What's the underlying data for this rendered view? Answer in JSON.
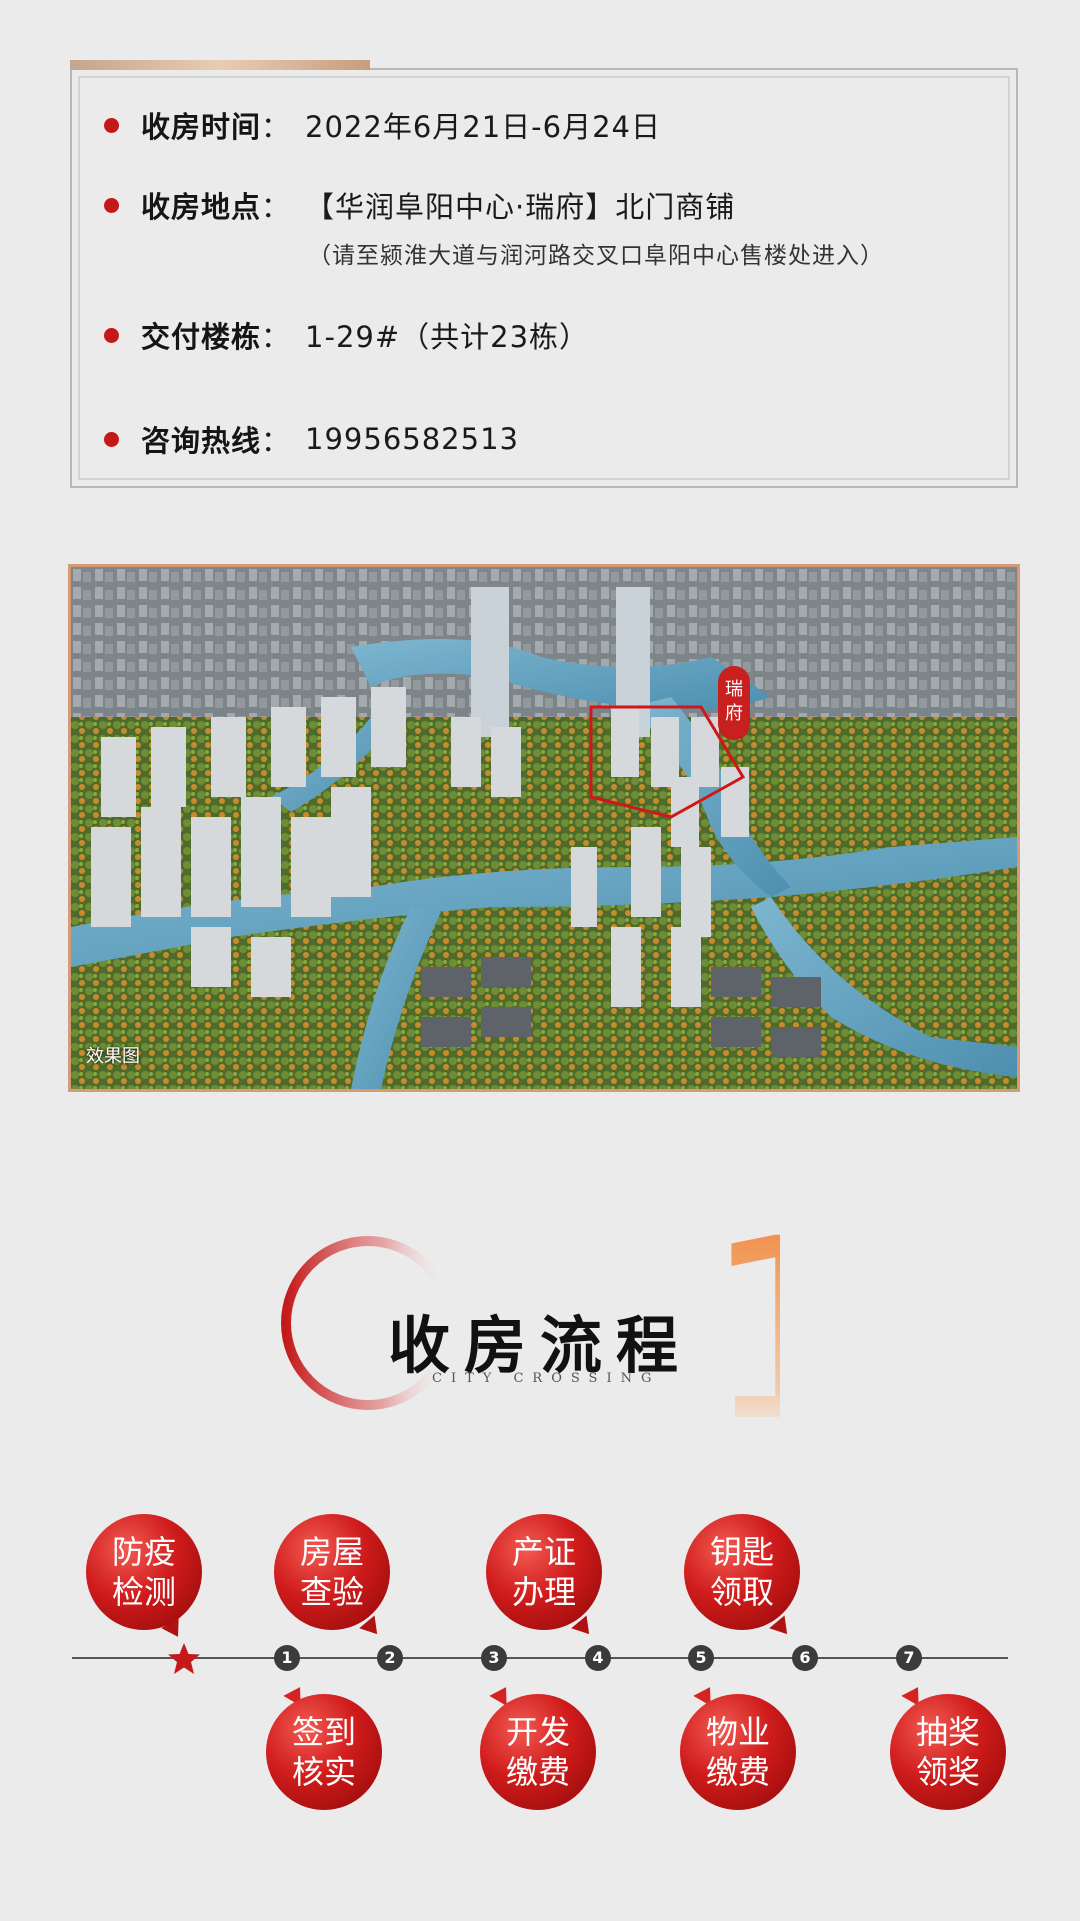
{
  "info": {
    "rows": [
      {
        "label": "收房时间",
        "colon": "：",
        "value": "2022年6月21日-6月24日"
      },
      {
        "label": "收房地点",
        "colon": "：",
        "value": "【华润阜阳中心·瑞府】北门商铺"
      },
      {
        "label": "交付楼栋",
        "colon": "：",
        "value": "1-29#（共计23栋）"
      },
      {
        "label": "咨询热线",
        "colon": "：",
        "value": "19956582513"
      }
    ],
    "location_note": "（请至颍淮大道与润河路交叉口阜阳中心售楼处进入）"
  },
  "aerial": {
    "tag": "瑞府",
    "caption": "效果图"
  },
  "section": {
    "title": "收房流程",
    "subtitle": "CITY CROSSING",
    "number": "1"
  },
  "process": {
    "step_numbers": [
      "1",
      "2",
      "3",
      "4",
      "5",
      "6",
      "7"
    ],
    "top_steps": [
      {
        "line1": "防疫",
        "line2": "检测"
      },
      {
        "line1": "房屋",
        "line2": "查验"
      },
      {
        "line1": "产证",
        "line2": "办理"
      },
      {
        "line1": "钥匙",
        "line2": "领取"
      }
    ],
    "bottom_steps": [
      {
        "line1": "签到",
        "line2": "核实"
      },
      {
        "line1": "开发",
        "line2": "缴费"
      },
      {
        "line1": "物业",
        "line2": "缴费"
      },
      {
        "line1": "抽奖",
        "line2": "领奖"
      }
    ]
  },
  "colors": {
    "accent_red": "#c41919",
    "accent_orange": "#f07a2a",
    "background": "#ebebeb"
  }
}
